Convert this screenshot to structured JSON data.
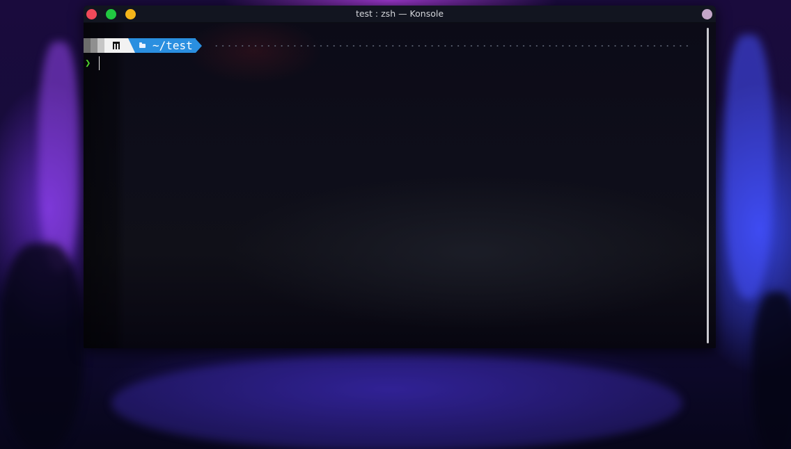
{
  "window": {
    "title": "test : zsh — Konsole",
    "buttons": {
      "close": "close",
      "maximize": "maximize",
      "minimize": "minimize",
      "pin": "keep-above"
    }
  },
  "prompt": {
    "os_icon": "manjaro-logo-icon",
    "folder_icon": "folder-open-icon",
    "directory": "~/test",
    "prompt_char": "❯",
    "directory_segment_color": "#2a8fe0",
    "prompt_char_color": "#4fd62c"
  },
  "input": {
    "value": ""
  }
}
